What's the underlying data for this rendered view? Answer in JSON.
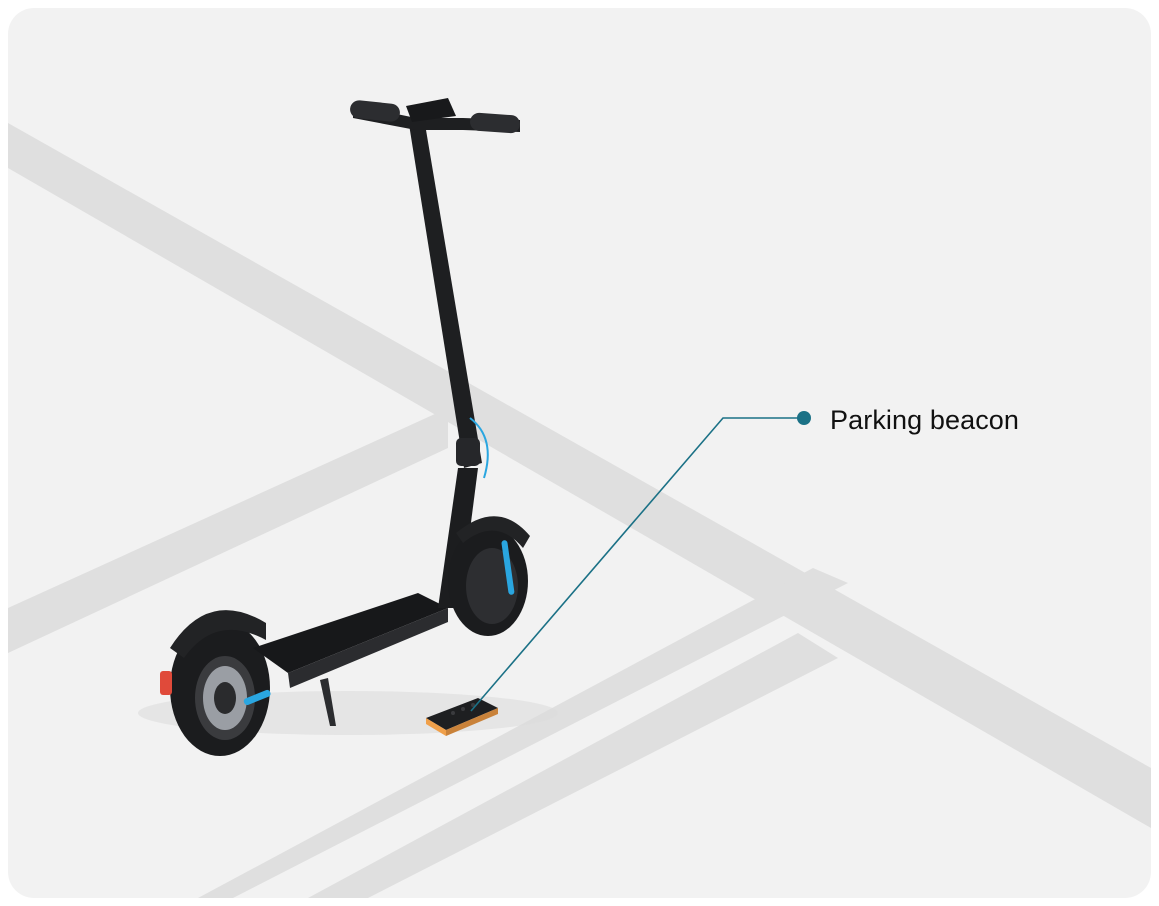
{
  "callout": {
    "label": "Parking beacon",
    "accent_color": "#1b7186"
  },
  "colors": {
    "background": "#f2f2f2",
    "road_markings": "#dedede",
    "scooter_body": "#1e1f21",
    "scooter_accent": "#2aa6e0",
    "beacon": "#f0a04a"
  }
}
